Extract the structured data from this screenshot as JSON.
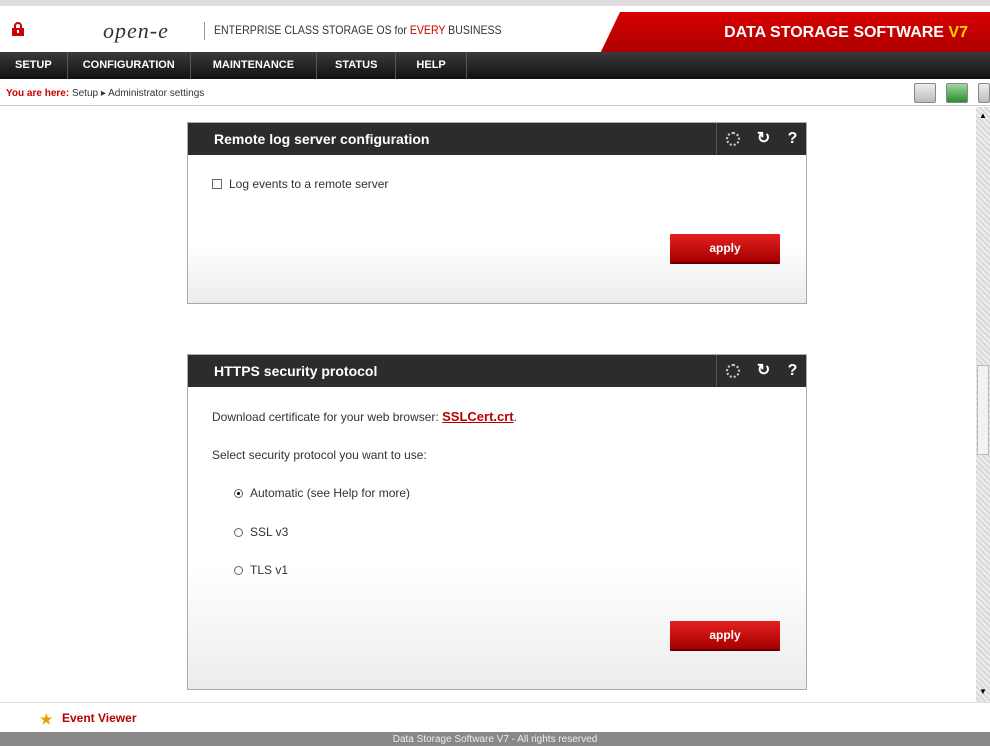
{
  "header": {
    "logo": "open-e",
    "tagline_prefix": "ENTERPRISE CLASS STORAGE OS for ",
    "tagline_highlight": "EVERY",
    "tagline_suffix": " BUSINESS",
    "brand_text": "DATA STORAGE SOFTWARE ",
    "brand_version": "V7"
  },
  "nav": {
    "items": [
      {
        "label": "SETUP"
      },
      {
        "label": "CONFIGURATION"
      },
      {
        "label": "MAINTENANCE"
      },
      {
        "label": "STATUS"
      },
      {
        "label": "HELP"
      }
    ]
  },
  "breadcrumb": {
    "prefix": "You are here:",
    "path": "Setup ▸ Administrator settings"
  },
  "remote_log": {
    "title": "Remote log server configuration",
    "checkbox_label": "Log events to a remote server",
    "apply_label": "apply"
  },
  "https": {
    "title": "HTTPS security protocol",
    "download_text": "Download certificate for your web browser: ",
    "download_link": "SSLCert.crt",
    "download_suffix": ".",
    "select_text": "Select security protocol you want to use:",
    "options": [
      {
        "label": "Automatic (see Help for more)",
        "selected": true
      },
      {
        "label": "SSL v3",
        "selected": false
      },
      {
        "label": "TLS v1",
        "selected": false
      }
    ],
    "apply_label": "apply"
  },
  "footer": {
    "event_viewer": "Event Viewer",
    "copyright": "Data Storage Software V7 - All rights reserved"
  },
  "colors": {
    "accent": "#c00000",
    "nav_bg": "#1a1a1a",
    "version": "#ffd200"
  }
}
